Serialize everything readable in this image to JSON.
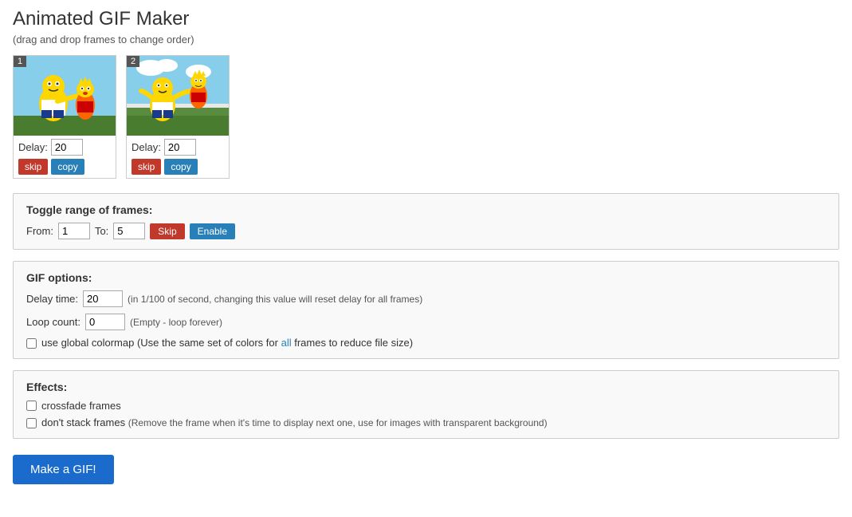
{
  "page": {
    "title": "Animated GIF Maker",
    "subtitle": "(drag and drop frames to change order)"
  },
  "frames": [
    {
      "number": "1",
      "delay_label": "Delay:",
      "delay_value": "20",
      "skip_label": "skip",
      "copy_label": "copy"
    },
    {
      "number": "2",
      "delay_label": "Delay:",
      "delay_value": "20",
      "skip_label": "skip",
      "copy_label": "copy"
    }
  ],
  "toggle_range": {
    "section_title": "Toggle range of frames:",
    "from_label": "From:",
    "from_value": "1",
    "to_label": "To:",
    "to_value": "5",
    "skip_label": "Skip",
    "enable_label": "Enable"
  },
  "gif_options": {
    "section_title": "GIF options:",
    "delay_label": "Delay time:",
    "delay_value": "20",
    "delay_hint": "(in 1/100 of second, changing this value will reset delay for all frames)",
    "loop_label": "Loop count:",
    "loop_value": "0",
    "loop_hint": "(Empty - loop forever)",
    "colormap_label": "use global colormap (Use the same set of colors for ",
    "colormap_link": "all",
    "colormap_label2": " frames to reduce file size)"
  },
  "effects": {
    "section_title": "Effects:",
    "crossfade_label": "crossfade frames",
    "dont_stack_label": "don't stack frames",
    "dont_stack_hint": "(Remove the frame when it's time to display next one, use for images with transparent background)"
  },
  "make_gif": {
    "button_label": "Make a GIF!"
  }
}
